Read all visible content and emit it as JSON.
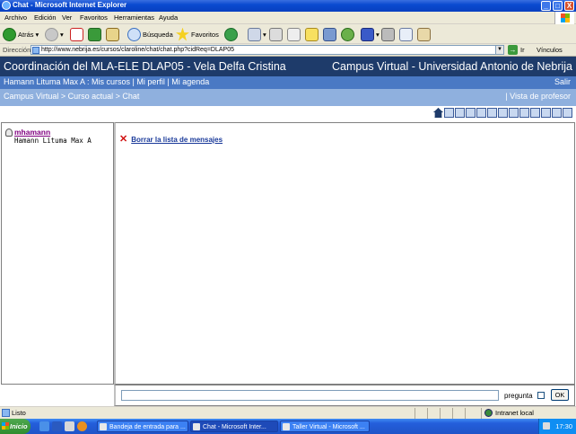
{
  "window": {
    "title": "Chat - Microsoft Internet Explorer",
    "buttons": {
      "minimize": "_",
      "maximize": "□",
      "close": "X"
    }
  },
  "menu": {
    "items": [
      "Archivo",
      "Edición",
      "Ver",
      "Favoritos",
      "Herramientas",
      "Ayuda"
    ]
  },
  "toolbar": {
    "back_label": "Atrás",
    "search_label": "Búsqueda",
    "favorites_label": "Favoritos"
  },
  "address": {
    "label": "Dirección",
    "url": "http://www.nebrija.es/cursos/claroline/chat/chat.php?cidReq=DLAP05",
    "go_label": "Ir",
    "links_label": "Vínculos"
  },
  "page": {
    "course_title": "Coordinación del MLA-ELE DLAP05 - Vela Delfa Cristina",
    "site_title": "Campus Virtual - Universidad Antonio de Nebrija",
    "user_line": "Hamann Lituma Max A : Mis cursos | Mi perfil | Mi agenda",
    "logout": "Salir",
    "breadcrumb": "Campus Virtual > Curso actual > Chat",
    "teacher_view": "|  Vista de profesor"
  },
  "chat": {
    "users": [
      {
        "login": "mhamann",
        "name": "Hamann Lituma Max A"
      }
    ],
    "clear_link": "Borrar la lista de mensajes",
    "message_value": "",
    "question_label": "pregunta",
    "question_checked": false,
    "ok_label": "OK"
  },
  "status": {
    "text": "Listo",
    "zone": "Intranet local"
  },
  "taskbar": {
    "start_label": "Inicio",
    "tasks": [
      "Bandeja de entrada para ...",
      "Chat - Microsoft Inter...",
      "Taller Virtual - Microsoft ..."
    ],
    "clock": "17:30"
  }
}
